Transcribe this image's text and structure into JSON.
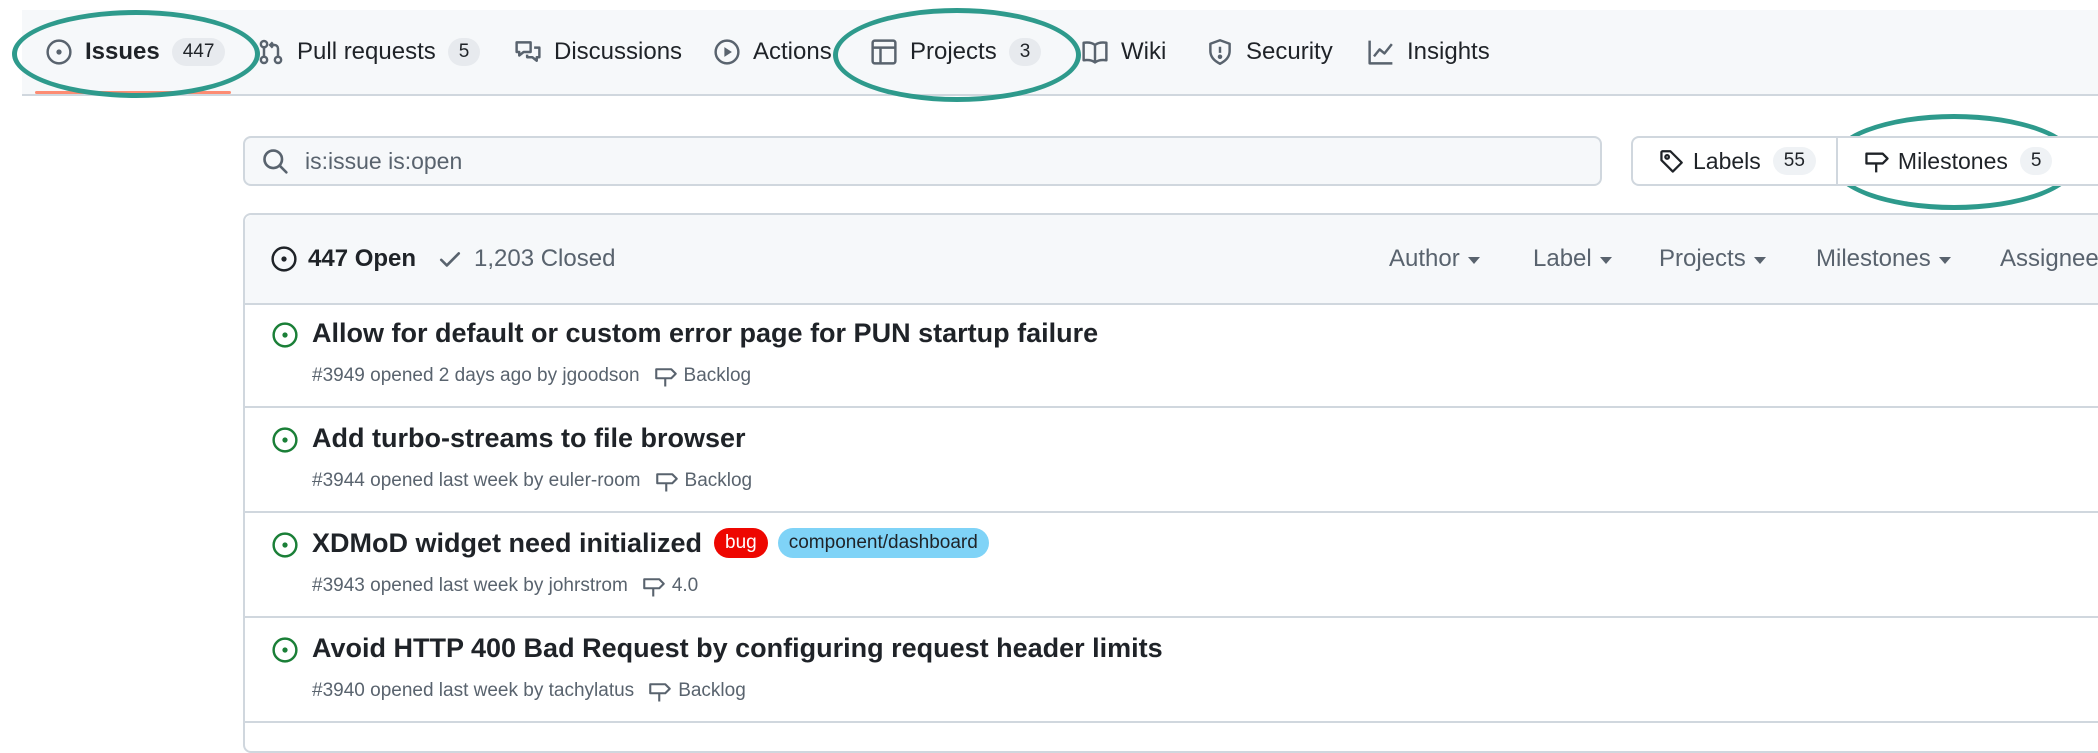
{
  "nav": {
    "tabs": [
      {
        "label": "Issues",
        "count": "447",
        "icon": "issue-opened-icon",
        "selected": true
      },
      {
        "label": "Pull requests",
        "count": "5",
        "icon": "git-pull-request-icon"
      },
      {
        "label": "Discussions",
        "icon": "comment-discussion-icon"
      },
      {
        "label": "Actions",
        "icon": "play-icon"
      },
      {
        "label": "Projects",
        "count": "3",
        "icon": "table-icon"
      },
      {
        "label": "Wiki",
        "icon": "book-icon"
      },
      {
        "label": "Security",
        "icon": "shield-icon"
      },
      {
        "label": "Insights",
        "icon": "graph-icon"
      }
    ]
  },
  "search": {
    "value": "is:issue is:open",
    "icon": "search-icon"
  },
  "toolbar": {
    "labels": {
      "label": "Labels",
      "count": "55",
      "icon": "tag-icon"
    },
    "milestones": {
      "label": "Milestones",
      "count": "5",
      "icon": "milestone-icon"
    }
  },
  "issues_header": {
    "open": "447 Open",
    "closed": "1,203 Closed",
    "filters": [
      "Author",
      "Label",
      "Projects",
      "Milestones",
      "Assignee"
    ]
  },
  "issues": [
    {
      "title": "Allow for default or custom error page for PUN startup failure",
      "number": "#3949",
      "opened": " opened 2 days ago by ",
      "author": "jgoodson",
      "milestone": "Backlog",
      "labels": []
    },
    {
      "title": "Add turbo-streams to file browser",
      "number": "#3944",
      "opened": " opened last week by ",
      "author": "euler-room",
      "milestone": "Backlog",
      "labels": []
    },
    {
      "title": "XDMoD widget need initialized",
      "number": "#3943",
      "opened": " opened last week by ",
      "author": "johrstrom",
      "milestone": "4.0",
      "labels": [
        "bug",
        "component/dashboard"
      ]
    },
    {
      "title": "Avoid HTTP 400 Bad Request by configuring request header limits",
      "number": "#3940",
      "opened": " opened last week by ",
      "author": "tachylatus",
      "milestone": "Backlog",
      "labels": []
    }
  ],
  "colors": {
    "open_state": "#1a7f37",
    "highlight_ring": "#2e9a8c",
    "selected_underline": "#fd8c73",
    "label_bug": "#ee0701",
    "label_component": "#7fd3f7"
  }
}
